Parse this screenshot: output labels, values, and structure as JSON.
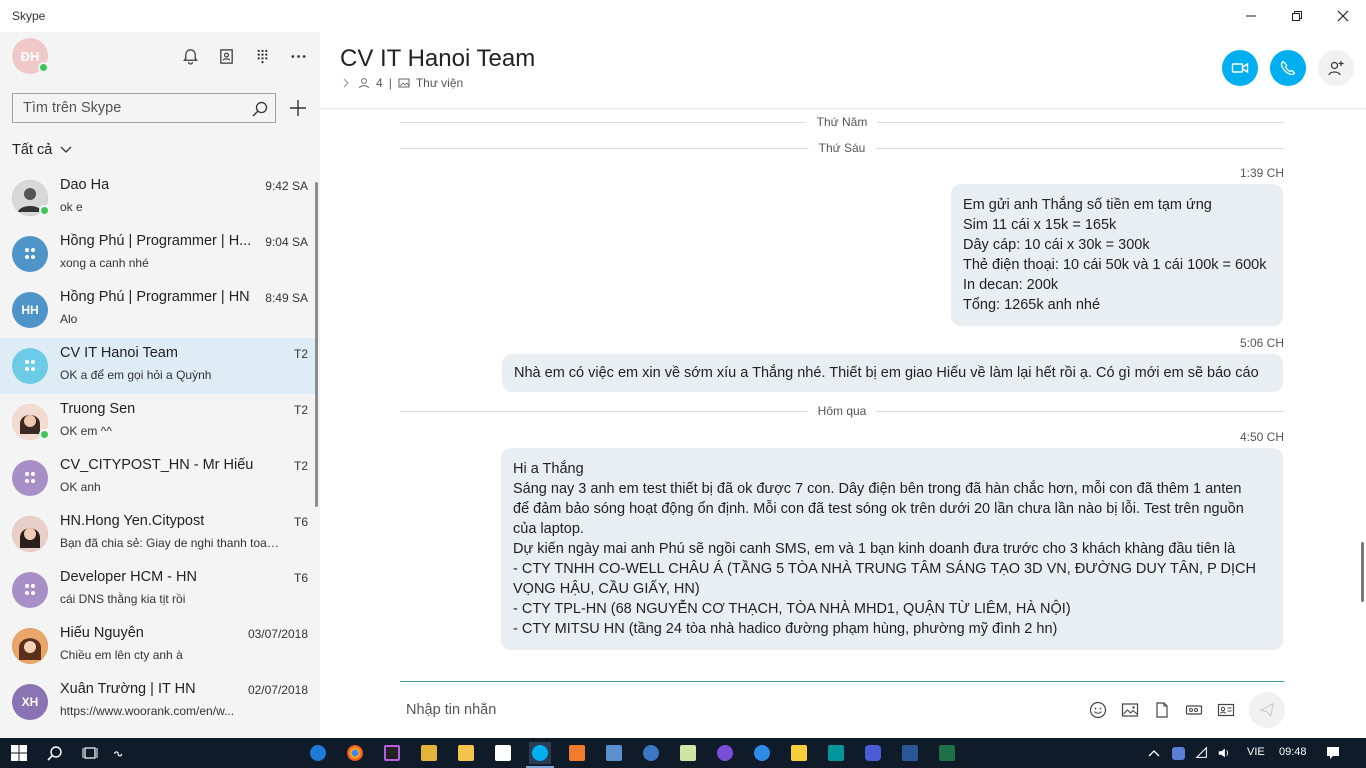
{
  "window": {
    "title": "Skype"
  },
  "profile": {
    "initials": "ĐH"
  },
  "search": {
    "placeholder": "Tìm trên Skype"
  },
  "filter": {
    "label": "Tất cả"
  },
  "chats": [
    {
      "name": "Dao Ha",
      "preview": "ok e",
      "time": "9:42 SA",
      "avatar_initials": "",
      "avatar_color": "#6b6b6b",
      "online": true
    },
    {
      "name": "Hồng Phú | Programmer | H...",
      "preview": "xong a canh nhé",
      "time": "9:04 SA",
      "avatar_initials": "",
      "avatar_color": "#4e94c8",
      "online": false,
      "group": true
    },
    {
      "name": "Hồng Phú | Programmer | HN",
      "preview": "Alo",
      "time": "8:49 SA",
      "avatar_initials": "HH",
      "avatar_color": "#4e94c8",
      "online": false
    },
    {
      "name": "CV IT Hanoi Team",
      "preview": "OK a để em gọi hỏi a Quỳnh",
      "time": "T2",
      "avatar_initials": "",
      "avatar_color": "#6ccbe6",
      "online": false,
      "group": true
    },
    {
      "name": "Truong Sen",
      "preview": "OK em ^^",
      "time": "T2",
      "avatar_initials": "",
      "avatar_color": "#c98a7a",
      "online": true
    },
    {
      "name": "CV_CITYPOST_HN - Mr Hiếu",
      "preview": "OK anh",
      "time": "T2",
      "avatar_initials": "",
      "avatar_color": "#a98fc7",
      "online": false,
      "group": true
    },
    {
      "name": "HN.Hong Yen.Citypost",
      "preview": "Bạn đã chia sẻ: Giay de nghi thanh toan...",
      "time": "T6",
      "avatar_initials": "",
      "avatar_color": "#b57a8c",
      "online": false
    },
    {
      "name": "Developer HCM - HN",
      "preview": "cái DNS thằng kia tịt rồi",
      "time": "T6",
      "avatar_initials": "",
      "avatar_color": "#a98fc7",
      "online": false,
      "group": true
    },
    {
      "name": "Hiếu Nguyễn",
      "preview": "Chiều em lên cty anh à",
      "time": "03/07/2018",
      "avatar_initials": "",
      "avatar_color": "#c97b4f",
      "online": false
    },
    {
      "name": "Xuân Trường | IT HN",
      "preview": "https://www.woorank.com/en/w...",
      "time": "02/07/2018",
      "avatar_initials": "XH",
      "avatar_color": "#8a73b3",
      "online": false
    }
  ],
  "conversation": {
    "title": "CV IT Hanoi Team",
    "participants": "4",
    "separator": "|",
    "library": "Thư viện"
  },
  "days": {
    "thu_nam": "Thứ Năm",
    "thu_sau": "Thứ Sáu",
    "hom_qua": "Hôm qua"
  },
  "messages": [
    {
      "time": "1:39 CH",
      "lines": [
        "Em gửi anh Thắng số tiền em tạm ứng",
        "Sim 11 cái x 15k = 165k",
        "Dây cáp: 10 cái x 30k = 300k",
        "Thẻ điện thoại: 10 cái 50k và 1 cái 100k = 600k",
        "In decan: 200k",
        "Tổng: 1265k anh nhé"
      ]
    },
    {
      "time": "5:06 CH",
      "lines": [
        "Nhà em có việc em xin về sớm xíu a Thắng nhé. Thiết bị em giao Hiếu về làm lại hết rồi ạ. Có gì mới em sẽ báo cáo"
      ]
    },
    {
      "time": "4:50 CH",
      "lines": [
        "Hi a Thắng",
        "Sáng nay 3 anh em test thiết bị đã ok được 7 con. Dây điện bên trong đã hàn chắc hơn, mỗi con đã thêm 1 anten",
        "để đảm bảo sóng hoạt động ổn định. Mỗi con đã test sóng ok trên dưới 20 lần chưa lần nào bị lỗi. Test trên nguồn",
        "của laptop.",
        "Dự kiến ngày mai anh Phú sẽ ngồi canh SMS, em và 1 bạn kinh doanh đưa trước cho 3 khách khàng đầu tiên là",
        "- CTY TNHH CO-WELL CHÂU Á (TẦNG 5 TÒA NHÀ TRUNG TÂM SÁNG TẠO 3D VN, ĐƯỜNG DUY TÂN, P DỊCH",
        "VỌNG HẬU, CẦU GIẤY, HN)",
        "- CTY TPL-HN (68 NGUYỄN CƠ THẠCH, TÒA NHÀ MHD1, QUẬN TỪ LIÊM, HÀ NỘI)",
        "- CTY MITSU HN (tầng 24 tòa nhà hadico đường phạm hùng, phường mỹ đình 2 hn)"
      ]
    }
  ],
  "compose": {
    "placeholder": "Nhập tin nhắn"
  },
  "taskbar": {
    "language": "VIE",
    "clock": "09:48"
  },
  "colors": {
    "accent": "#00aff0",
    "active_row": "#ddecf5",
    "bubble": "#e9eef2"
  }
}
